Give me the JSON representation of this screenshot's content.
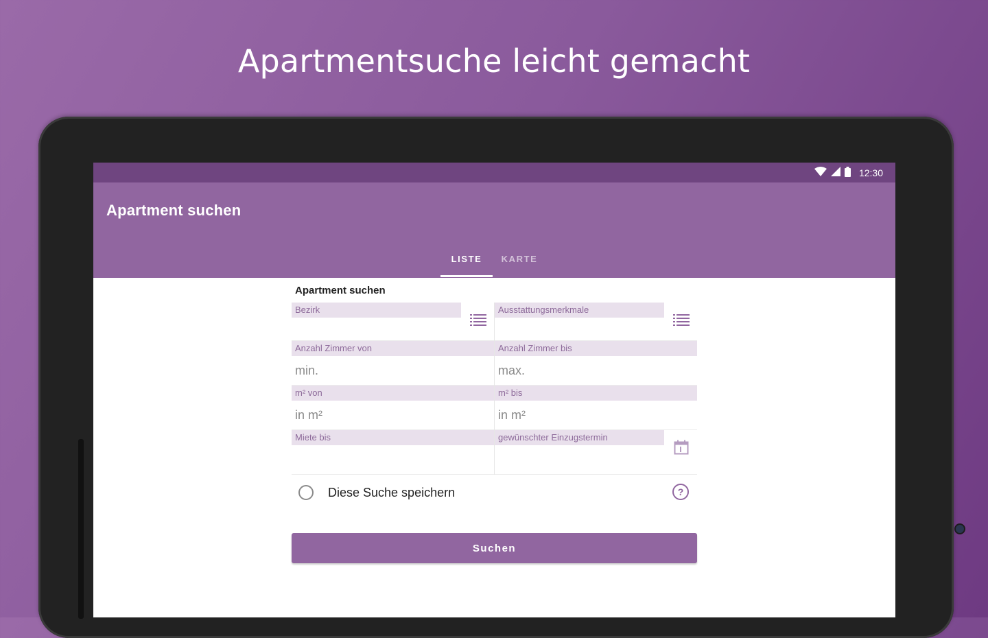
{
  "headline": "Apartmentsuche leicht gemacht",
  "status": {
    "time": "12:30"
  },
  "appbar": {
    "title": "Apartment suchen"
  },
  "tabs": [
    {
      "label": "LISTE",
      "active": true
    },
    {
      "label": "KARTE",
      "active": false
    }
  ],
  "form": {
    "title": "Apartment suchen",
    "district": {
      "label": "Bezirk"
    },
    "features": {
      "label": "Ausstattungsmerkmale"
    },
    "rooms_from": {
      "label": "Anzahl Zimmer von",
      "placeholder": "min."
    },
    "rooms_to": {
      "label": "Anzahl Zimmer bis",
      "placeholder": "max."
    },
    "area_from": {
      "label": "m² von",
      "placeholder": "in m²"
    },
    "area_to": {
      "label": "m² bis",
      "placeholder": "in m²"
    },
    "rent_to": {
      "label": "Miete bis",
      "placeholder": ""
    },
    "move_in": {
      "label": "gewünschter Einzugstermin"
    },
    "save_search_label": "Diese Suche speichern",
    "help_symbol": "?",
    "search_button": "Suchen"
  },
  "colors": {
    "primary": "#9166a0",
    "status_bar": "#6f4580",
    "label_bg": "#e9e0ec"
  },
  "icons": [
    "wifi-icon",
    "signal-icon",
    "battery-icon",
    "list-icon",
    "calendar-icon",
    "help-icon"
  ]
}
